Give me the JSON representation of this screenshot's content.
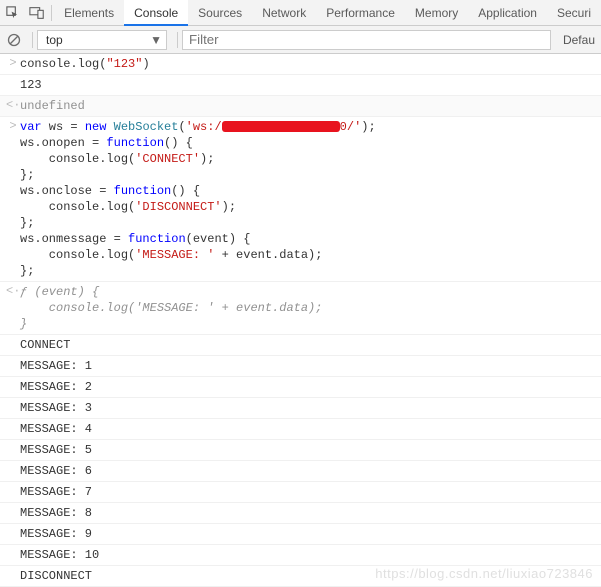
{
  "tabs": {
    "inspect_icon": "inspect",
    "device_icon": "device",
    "items": [
      "Elements",
      "Console",
      "Sources",
      "Network",
      "Performance",
      "Memory",
      "Application",
      "Securi"
    ],
    "active_index": 1
  },
  "filter_bar": {
    "context": "top",
    "filter_placeholder": "Filter",
    "levels": "Defau"
  },
  "entries": [
    {
      "gutter": ">",
      "type": "code",
      "text": "console.log(\"123\")"
    },
    {
      "gutter": "",
      "type": "plain",
      "text": "123",
      "indent": false
    },
    {
      "gutter": "<·",
      "type": "undef",
      "text": "undefined"
    },
    {
      "gutter": ">",
      "type": "ws_code"
    },
    {
      "gutter": "<·",
      "type": "fn_echo"
    },
    {
      "gutter": "",
      "type": "plain",
      "text": "CONNECT"
    },
    {
      "gutter": "",
      "type": "plain",
      "text": "MESSAGE: 1"
    },
    {
      "gutter": "",
      "type": "plain",
      "text": "MESSAGE: 2"
    },
    {
      "gutter": "",
      "type": "plain",
      "text": "MESSAGE: 3"
    },
    {
      "gutter": "",
      "type": "plain",
      "text": "MESSAGE: 4"
    },
    {
      "gutter": "",
      "type": "plain",
      "text": "MESSAGE: 5"
    },
    {
      "gutter": "",
      "type": "plain",
      "text": "MESSAGE: 6"
    },
    {
      "gutter": "",
      "type": "plain",
      "text": "MESSAGE: 7"
    },
    {
      "gutter": "",
      "type": "plain",
      "text": "MESSAGE: 8"
    },
    {
      "gutter": "",
      "type": "plain",
      "text": "MESSAGE: 9"
    },
    {
      "gutter": "",
      "type": "plain",
      "text": "MESSAGE: 10"
    },
    {
      "gutter": "",
      "type": "plain",
      "text": "DISCONNECT"
    }
  ],
  "ws_code": {
    "l1_pre": "var",
    "l1_var": " ws = ",
    "l1_new": "new",
    "l1_cls": " WebSocket",
    "l1_open": "(",
    "l1_str1": "'ws:/",
    "l1_str2": "0/'",
    "l1_close": ");",
    "l2": "ws.onopen = ",
    "l2_fn": "function",
    "l2_rest": "() {",
    "l3_a": "    console.log(",
    "l3_s": "'CONNECT'",
    "l3_b": ");",
    "l4": "};",
    "l5": "ws.onclose = ",
    "l5_fn": "function",
    "l5_rest": "() {",
    "l6_a": "    console.log(",
    "l6_s": "'DISCONNECT'",
    "l6_b": ");",
    "l7": "};",
    "l8": "ws.onmessage = ",
    "l8_fn": "function",
    "l8_arg": "(event) {",
    "l9_a": "    console.log(",
    "l9_s": "'MESSAGE: '",
    "l9_b": " + event.data);",
    "l10": "};"
  },
  "fn_echo": {
    "l1": "ƒ (event) {",
    "l2": "    console.log('MESSAGE: ' + event.data);",
    "l3": "}"
  },
  "watermark": "https://blog.csdn.net/liuxiao723846"
}
